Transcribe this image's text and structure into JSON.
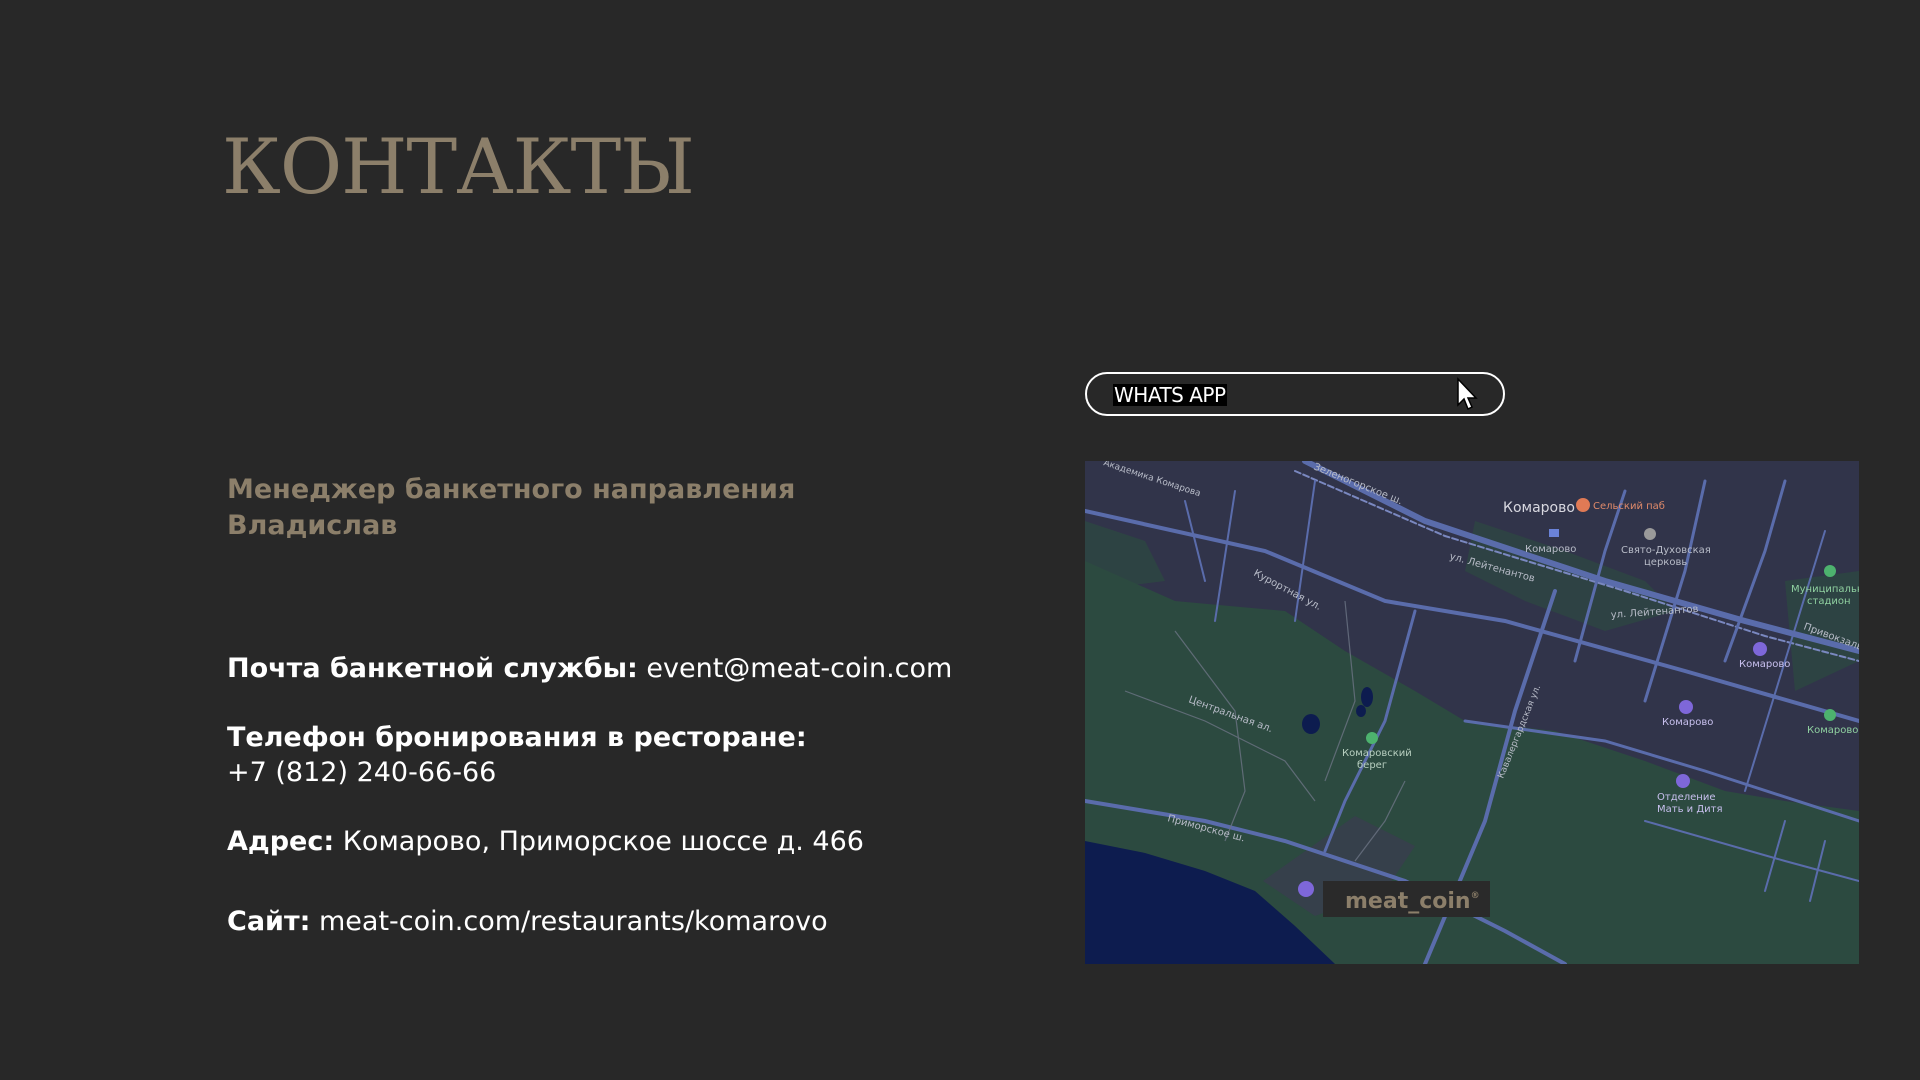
{
  "page": {
    "title": "КОНТАКТЫ"
  },
  "manager": {
    "role": "Менеджер банкетного направления",
    "name": "Владислав"
  },
  "contacts": {
    "email": {
      "label": "Почта банкетной службы:",
      "value": "event@meat-coin.com"
    },
    "phone": {
      "label": "Телефон бронирования в ресторане:",
      "value": "+7 (812) 240-66-66"
    },
    "address": {
      "label": "Адрес:",
      "value": "Комарово, Приморское шоссе д. 466"
    },
    "site": {
      "label": "Сайт:",
      "value": "meat-coin.com/restaurants/komarovo"
    }
  },
  "whatsapp": {
    "label": "WHATS APP",
    "icon": "cursor-arrow-icon"
  },
  "map": {
    "colors": {
      "land": "#31344a",
      "forest": "#2c4a40",
      "water": "#0d1c4f",
      "road": "#5a6cab",
      "poi": "#7e67d9",
      "green_poi": "#4db26e",
      "food_poi": "#e07a55"
    },
    "labels": {
      "komarovo_main": "Комарово",
      "pub": "Сельский паб",
      "station": "Комарово",
      "church_1": "Свято-Духовская",
      "church_2": "церковь",
      "stadium_1": "Муниципальн",
      "stadium_2": "стадион",
      "komarovo_a": "Комарово",
      "komarovo_b": "Комарово",
      "komarovo_c": "Комарово",
      "branch_1": "Отделение",
      "branch_2": "Мать и Дитя",
      "bereg_1": "Комаровский",
      "bereg_2": "берег",
      "central_alley": "Центральная ал.",
      "primorskoe": "Приморское ш.",
      "zelenogorskoe": "Зеленогорское ш.",
      "leytenantov_1": "ул. Лейтенантов",
      "leytenantov_2": "ул. Лейтенантов",
      "kurortnaya": "Курортная ул.",
      "privokzalnaya": "Привокзальная ул.",
      "komarova": "Академика Комарова",
      "kavalergardskaya": "Кавалергардская ул.",
      "privokzal_right": "Привокзальн",
      "pin": "meat_coin",
      "pin_mark": "®"
    }
  }
}
